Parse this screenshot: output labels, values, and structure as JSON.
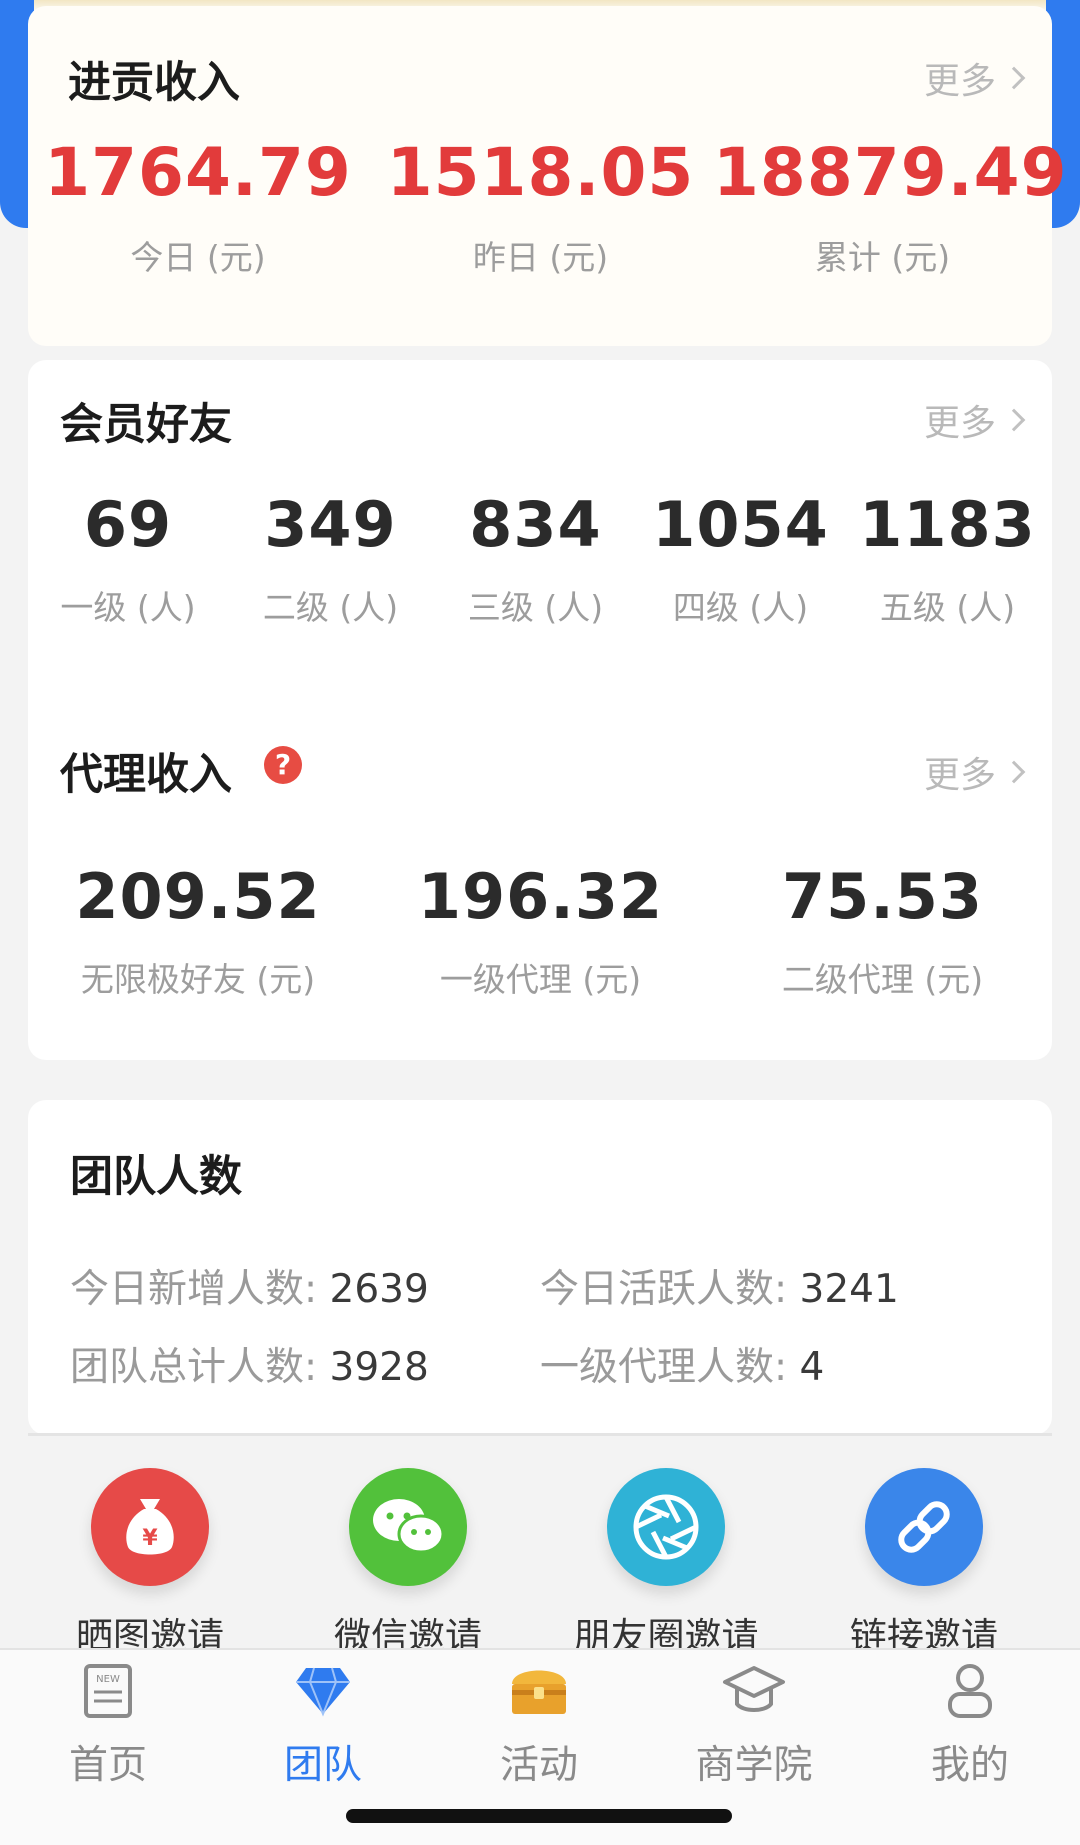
{
  "income": {
    "title": "进贡收入",
    "more": "更多",
    "stats": [
      {
        "value": "1764.79",
        "label": "今日 (元)"
      },
      {
        "value": "1518.05",
        "label": "昨日 (元)"
      },
      {
        "value": "18879.49",
        "label": "累计 (元)"
      }
    ]
  },
  "members": {
    "title": "会员好友",
    "more": "更多",
    "stats": [
      {
        "value": "69",
        "label": "一级 (人)"
      },
      {
        "value": "349",
        "label": "二级 (人)"
      },
      {
        "value": "834",
        "label": "三级 (人)"
      },
      {
        "value": "1054",
        "label": "四级 (人)"
      },
      {
        "value": "1183",
        "label": "五级 (人)"
      }
    ]
  },
  "agent": {
    "title": "代理收入",
    "help": "?",
    "more": "更多",
    "stats": [
      {
        "value": "209.52",
        "label": "无限极好友 (元)"
      },
      {
        "value": "196.32",
        "label": "一级代理 (元)"
      },
      {
        "value": "75.53",
        "label": "二级代理 (元)"
      }
    ]
  },
  "team": {
    "title": "团队人数",
    "rows": [
      {
        "label": "今日新增人数: ",
        "value": "2639"
      },
      {
        "label": "今日活跃人数: ",
        "value": "3241"
      },
      {
        "label": "团队总计人数: ",
        "value": "3928"
      },
      {
        "label": "一级代理人数: ",
        "value": "4"
      }
    ]
  },
  "invites": [
    {
      "label": "晒图邀请",
      "icon": "money-bag-icon",
      "color": "#e64a48"
    },
    {
      "label": "微信邀请",
      "icon": "wechat-icon",
      "color": "#52c13b"
    },
    {
      "label": "朋友圈邀请",
      "icon": "aperture-icon",
      "color": "#2fb2d6"
    },
    {
      "label": "链接邀请",
      "icon": "link-icon",
      "color": "#3a86ea"
    }
  ],
  "tabs": [
    {
      "label": "首页",
      "icon": "news-icon"
    },
    {
      "label": "团队",
      "icon": "diamond-icon",
      "active": true
    },
    {
      "label": "活动",
      "icon": "treasure-chest-icon"
    },
    {
      "label": "商学院",
      "icon": "graduation-cap-icon"
    },
    {
      "label": "我的",
      "icon": "user-icon"
    }
  ],
  "colors": {
    "accent": "#2f7bef",
    "red": "#e23b3b"
  }
}
